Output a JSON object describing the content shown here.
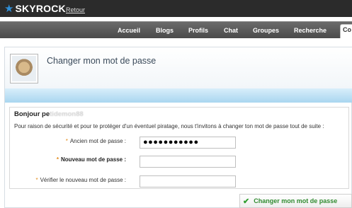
{
  "brand": {
    "name": "SKYROCK",
    "back_link": "Retour"
  },
  "nav": {
    "items": [
      {
        "label": "Accueil"
      },
      {
        "label": "Blogs"
      },
      {
        "label": "Profils"
      },
      {
        "label": "Chat"
      },
      {
        "label": "Groupes"
      },
      {
        "label": "Recherche"
      }
    ],
    "current": "Co"
  },
  "page": {
    "title": "Changer mon mot de passe"
  },
  "form": {
    "greeting_prefix": "Bonjour pe",
    "greeting_user": "tidemon88",
    "intro": "Pour raison de sécurité et pour te protéger d'un éventuel piratage, nous t'invitons à changer ton mot de passe tout de suite :",
    "required_mark": "*",
    "fields": [
      {
        "label": "Ancien mot de passe :",
        "value": "●●●●●●●●●●●",
        "bold": false
      },
      {
        "label": "Nouveau mot de passe :",
        "value": "",
        "bold": true
      },
      {
        "label": "Vérifier le nouveau mot de passe :",
        "value": "",
        "bold": false
      }
    ],
    "submit_label": "Changer mon mot de passe"
  },
  "colors": {
    "topbar": "#2b2b2b",
    "accent_blue": "#2f8fd8",
    "required": "#e38b1a",
    "submit_green": "#2f8a2f"
  }
}
